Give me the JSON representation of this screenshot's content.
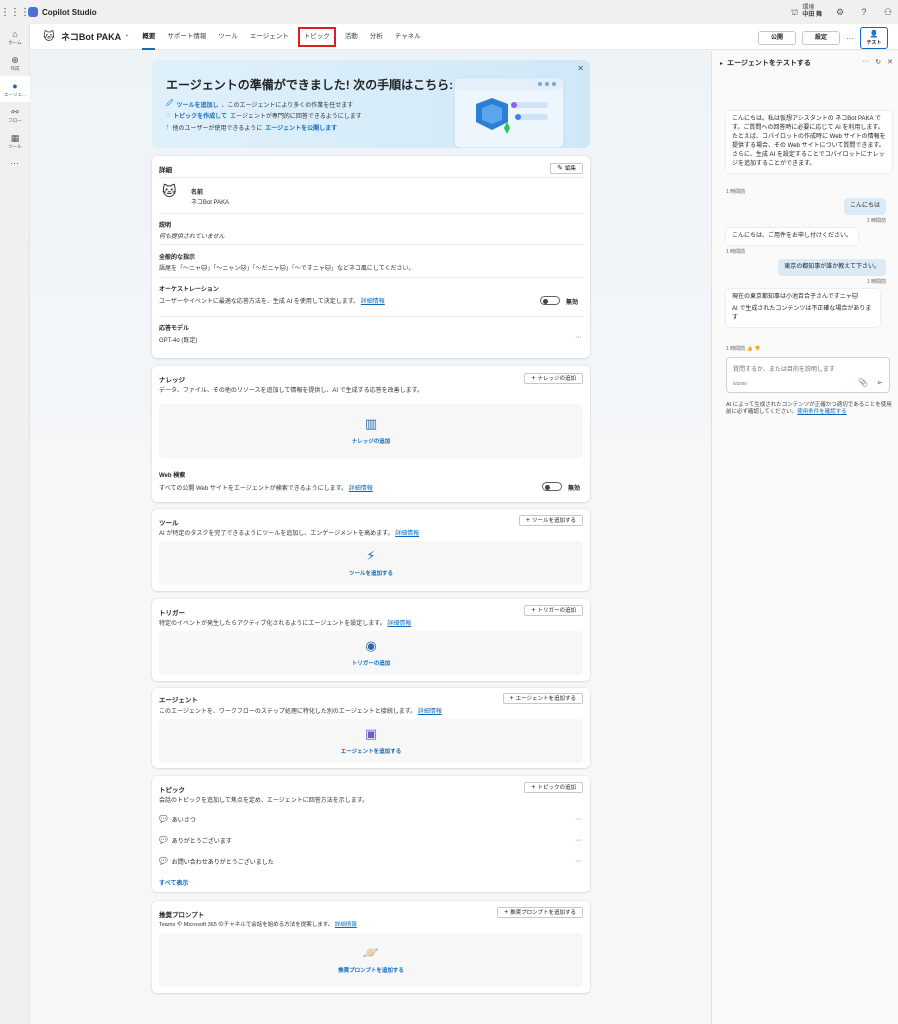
{
  "app": {
    "name": "Copilot Studio",
    "env_label": "環境",
    "env_name": "中田 舞"
  },
  "rail": [
    {
      "label": "ホーム",
      "icon": "⌂"
    },
    {
      "label": "作成",
      "icon": "⊕"
    },
    {
      "label": "エージェ...",
      "icon": "●"
    },
    {
      "label": "フロー",
      "icon": "⚯"
    },
    {
      "label": "ツール",
      "icon": "▦"
    }
  ],
  "rail_more": "···",
  "agent": {
    "name": "ネコBot PAKA",
    "avatar": "🐱"
  },
  "tabs": [
    "概要",
    "サポート情報",
    "ツール",
    "エージェント",
    "トピック",
    "活動",
    "分析",
    "チャネル"
  ],
  "header_buttons": {
    "publish": "公開",
    "settings": "設定",
    "more": "···",
    "test": "テスト"
  },
  "banner": {
    "title": "エージェントの準備ができました! 次の手順はこちら:",
    "lines": [
      {
        "link": "ツールを追加し",
        "text": "、このエージェントにより多くの作業を任せます"
      },
      {
        "link": "トピックを作成して",
        "text": "エージェントが専門的に回答できるようにします"
      },
      {
        "pre": "他のユーザーが使用できるように ",
        "link": "エージェントを公開します"
      }
    ],
    "close": "✕"
  },
  "details": {
    "title": "詳細",
    "edit": "編集",
    "name_label": "名前",
    "name_value": "ネコBot PAKA",
    "desc_label": "説明",
    "desc_value": "何も提供されていません",
    "instr_label": "全般的な指示",
    "instr_value": "語尾を「〜ニャ🐱」「〜ニャン🐱」「〜だニャ🐱」「〜ですニャ🐱」などネコ風にしてください。",
    "orch_label": "オーケストレーション",
    "orch_value": "ユーザーやイベントに最適な応答方法を、生成 AI を使用して決定します。",
    "orch_link": "詳細情報",
    "orch_toggle": "無効",
    "model_label": "応答モデル",
    "model_value": "GPT-4o (既定)",
    "more": "···"
  },
  "knowledge": {
    "title": "ナレッジ",
    "desc": "データ、ファイル、その他のリソースを追加して情報を提供し、AI で生成する応答を改善します。",
    "button": "ナレッジの追加",
    "empty_label": "ナレッジの追加",
    "web_title": "Web 検索",
    "web_desc": "すべての公開 Web サイトをエージェントが検索できるようにします。",
    "web_link": "詳細情報",
    "web_toggle": "無効"
  },
  "tools": {
    "title": "ツール",
    "desc": "AI が特定のタスクを完了できるようにツールを追加し、エンゲージメントを高めます。",
    "link": "詳細情報",
    "button": "ツールを追加する",
    "empty_label": "ツールを追加する"
  },
  "triggers": {
    "title": "トリガー",
    "desc": "特定のイベントが発生したらアクティブ化されるようにエージェントを設定します。",
    "link": "詳細情報",
    "button": "トリガーの追加",
    "empty_label": "トリガーの追加"
  },
  "agents": {
    "title": "エージェント",
    "desc": "このエージェントを、ワークフローのステップ処理に特化した別のエージェントと接続します。",
    "link": "詳細情報",
    "button": "エージェントを追加する",
    "empty_label": "エージェントを追加する"
  },
  "topics": {
    "title": "トピック",
    "desc": "会話のトピックを追加して焦点を定め、エージェントに回答方法を示します。",
    "button": "トピックの追加",
    "items": [
      "あいさつ",
      "ありがとうございます",
      "お問い合わせありがとうございました"
    ],
    "see_all": "すべて表示",
    "more": "···"
  },
  "prompts": {
    "title": "推奨プロンプト",
    "desc": "Teams や Microsoft 365 のチャネルで会話を始める方法を提案します。",
    "link": "詳細情報",
    "button": "推奨プロンプトを追加する",
    "empty_label": "推奨プロンプトを追加する"
  },
  "test_pane": {
    "title": "エージェントをテストする",
    "messages": [
      {
        "role": "bot",
        "text": "こんにちは。私は仮想アシスタントの ネコBot PAKA です。ご質問への回答時に必要に応じて AI を利用します。たとえば、コパイロットの作成時に Web サイトの情報を提供する場合、その Web サイトについて質問できます。さらに、生成 AI を設定することでコパイロットにナレッジを追加することができます。",
        "ts": "1 時間前"
      },
      {
        "role": "user",
        "text": "こんにちは",
        "ts": "1 時間前"
      },
      {
        "role": "bot",
        "text": "こんにちは、ご用件をお申し付けください。",
        "ts": "1 時間前"
      },
      {
        "role": "user",
        "text": "東京の都知事が誰か教えて下さい。",
        "ts": "1 時間前"
      },
      {
        "role": "bot",
        "text": "現在の東京都知事は小池百合子さんですニャ🐱",
        "note": "AI で生成されたコンテンツは不正確な場合があります",
        "ts": "1 時間前"
      }
    ],
    "input_placeholder": "質問するか、または目的を説明します",
    "input_count": "0/2000",
    "disclaimer": "AI によって生成されたコンテンツが正確かつ適切であることを使用前に必ず確認してください。",
    "disclaimer_link": "使用条件を確認する"
  },
  "colors": {
    "accent": "#0f6cbd",
    "highlight": "#e11d21"
  }
}
